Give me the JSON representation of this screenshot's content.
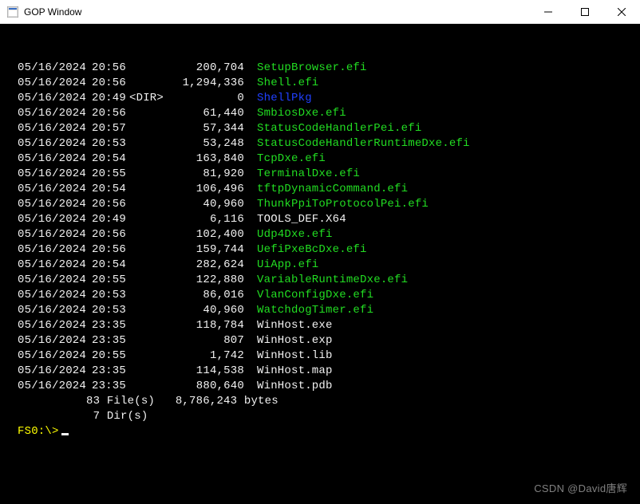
{
  "window": {
    "title": "GOP Window"
  },
  "rows": [
    {
      "date": "05/16/2024",
      "time": "20:56",
      "dir": "",
      "size": "200,704",
      "name": "SetupBrowser.efi",
      "color": "green"
    },
    {
      "date": "05/16/2024",
      "time": "20:56",
      "dir": "",
      "size": "1,294,336",
      "name": "Shell.efi",
      "color": "green"
    },
    {
      "date": "05/16/2024",
      "time": "20:49",
      "dir": "<DIR>",
      "size": "0",
      "name": "ShellPkg",
      "color": "blue"
    },
    {
      "date": "05/16/2024",
      "time": "20:56",
      "dir": "",
      "size": "61,440",
      "name": "SmbiosDxe.efi",
      "color": "green"
    },
    {
      "date": "05/16/2024",
      "time": "20:57",
      "dir": "",
      "size": "57,344",
      "name": "StatusCodeHandlerPei.efi",
      "color": "green"
    },
    {
      "date": "05/16/2024",
      "time": "20:53",
      "dir": "",
      "size": "53,248",
      "name": "StatusCodeHandlerRuntimeDxe.efi",
      "color": "green"
    },
    {
      "date": "05/16/2024",
      "time": "20:54",
      "dir": "",
      "size": "163,840",
      "name": "TcpDxe.efi",
      "color": "green"
    },
    {
      "date": "05/16/2024",
      "time": "20:55",
      "dir": "",
      "size": "81,920",
      "name": "TerminalDxe.efi",
      "color": "green"
    },
    {
      "date": "05/16/2024",
      "time": "20:54",
      "dir": "",
      "size": "106,496",
      "name": "tftpDynamicCommand.efi",
      "color": "green"
    },
    {
      "date": "05/16/2024",
      "time": "20:56",
      "dir": "",
      "size": "40,960",
      "name": "ThunkPpiToProtocolPei.efi",
      "color": "green"
    },
    {
      "date": "05/16/2024",
      "time": "20:49",
      "dir": "",
      "size": "6,116",
      "name": "TOOLS_DEF.X64",
      "color": "white"
    },
    {
      "date": "05/16/2024",
      "time": "20:56",
      "dir": "",
      "size": "102,400",
      "name": "Udp4Dxe.efi",
      "color": "green"
    },
    {
      "date": "05/16/2024",
      "time": "20:56",
      "dir": "",
      "size": "159,744",
      "name": "UefiPxeBcDxe.efi",
      "color": "green"
    },
    {
      "date": "05/16/2024",
      "time": "20:54",
      "dir": "",
      "size": "282,624",
      "name": "UiApp.efi",
      "color": "green"
    },
    {
      "date": "05/16/2024",
      "time": "20:55",
      "dir": "",
      "size": "122,880",
      "name": "VariableRuntimeDxe.efi",
      "color": "green"
    },
    {
      "date": "05/16/2024",
      "time": "20:53",
      "dir": "",
      "size": "86,016",
      "name": "VlanConfigDxe.efi",
      "color": "green"
    },
    {
      "date": "05/16/2024",
      "time": "20:53",
      "dir": "",
      "size": "40,960",
      "name": "WatchdogTimer.efi",
      "color": "green"
    },
    {
      "date": "05/16/2024",
      "time": "23:35",
      "dir": "",
      "size": "118,784",
      "name": "WinHost.exe",
      "color": "white"
    },
    {
      "date": "05/16/2024",
      "time": "23:35",
      "dir": "",
      "size": "807",
      "name": "WinHost.exp",
      "color": "white"
    },
    {
      "date": "05/16/2024",
      "time": "20:55",
      "dir": "",
      "size": "1,742",
      "name": "WinHost.lib",
      "color": "white"
    },
    {
      "date": "05/16/2024",
      "time": "23:35",
      "dir": "",
      "size": "114,538",
      "name": "WinHost.map",
      "color": "white"
    },
    {
      "date": "05/16/2024",
      "time": "23:35",
      "dir": "",
      "size": "880,640",
      "name": "WinHost.pdb",
      "color": "white"
    }
  ],
  "summary": {
    "files_line": "          83 File(s)   8,786,243 bytes",
    "dirs_line": "           7 Dir(s)"
  },
  "prompt": "FS0:\\> ",
  "watermark": "CSDN @David唐辉"
}
